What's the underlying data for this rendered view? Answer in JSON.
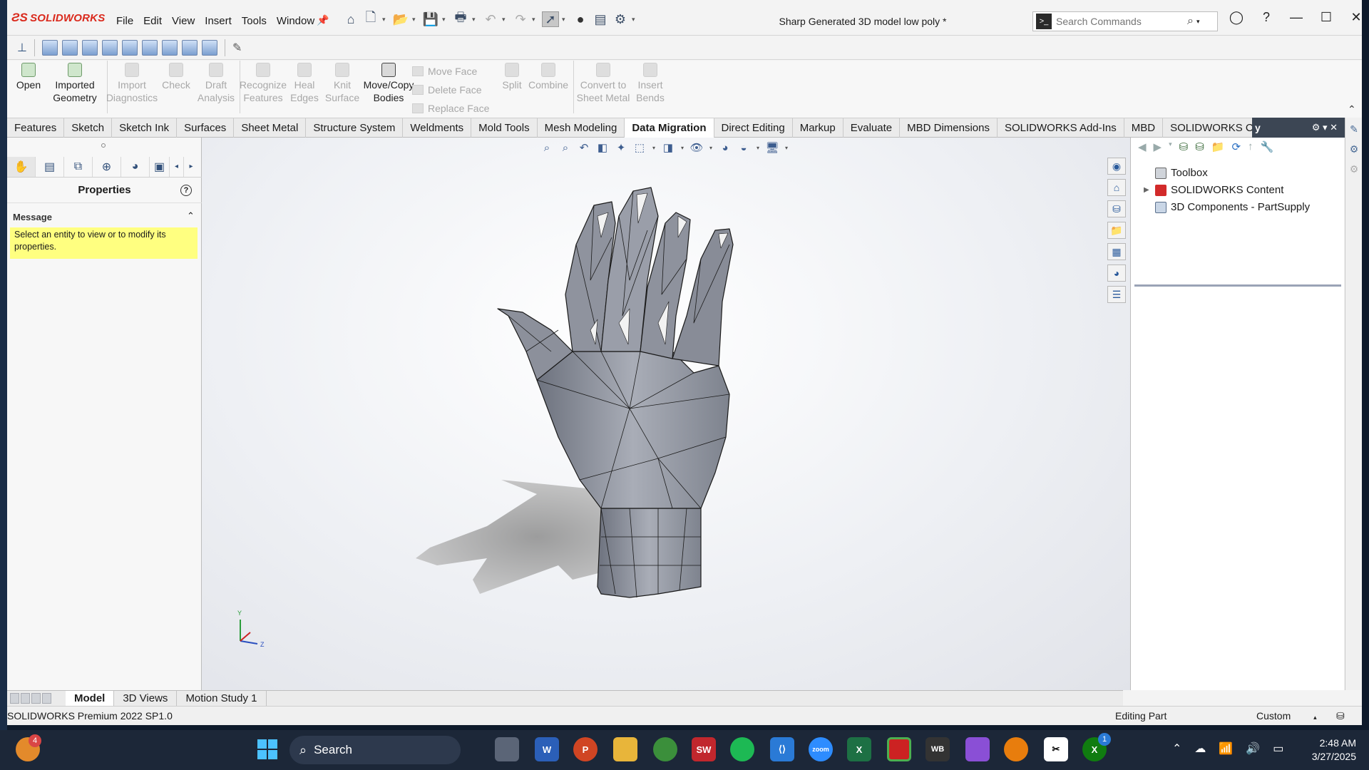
{
  "app": {
    "brand": "SOLIDWORKS",
    "doc_title": "Sharp Generated 3D model low poly *"
  },
  "menu": [
    "File",
    "Edit",
    "View",
    "Insert",
    "Tools",
    "Window"
  ],
  "search": {
    "placeholder": "Search Commands"
  },
  "commands": {
    "open": "Open",
    "imported": "Imported",
    "geometry": "Geometry",
    "import": "Import",
    "diagnostics": "Diagnostics",
    "check": "Check",
    "draft": "Draft",
    "analysis": "Analysis",
    "recognize": "Recognize",
    "features": "Features",
    "heal": "Heal",
    "edges": "Edges",
    "knit": "Knit",
    "surface": "Surface",
    "move_copy": "Move/Copy",
    "bodies": "Bodies",
    "move_face": "Move Face",
    "delete_face": "Delete Face",
    "replace_face": "Replace Face",
    "split": "Split",
    "combine": "Combine",
    "convert_to": "Convert to",
    "sheet_metal": "Sheet Metal",
    "insert": "Insert",
    "bends": "Bends"
  },
  "tabs": [
    "Features",
    "Sketch",
    "Sketch Ink",
    "Surfaces",
    "Sheet Metal",
    "Structure System",
    "Weldments",
    "Mold Tools",
    "Mesh Modeling",
    "Data Migration",
    "Direct Editing",
    "Markup",
    "Evaluate",
    "MBD Dimensions",
    "SOLIDWORKS Add-Ins",
    "MBD",
    "SOLIDWORKS CAM"
  ],
  "task_header": "y",
  "left_panel": {
    "title": "Properties",
    "message_header": "Message",
    "message": "Select an entity to view or to modify its properties."
  },
  "task_pane": {
    "items": [
      "Toolbox",
      "SOLIDWORKS Content",
      "3D Components - PartSupply"
    ]
  },
  "triad": {
    "y": "Y",
    "z": "Z"
  },
  "bottom_tabs": [
    "Model",
    "3D Views",
    "Motion Study 1"
  ],
  "status": {
    "left": "SOLIDWORKS Premium 2022 SP1.0",
    "mid": "Editing Part",
    "right": "Custom"
  },
  "taskbar": {
    "search": "Search",
    "time": "2:48 AM",
    "date": "3/27/2025",
    "badge_weather": "4",
    "badge_xbox": "1"
  }
}
